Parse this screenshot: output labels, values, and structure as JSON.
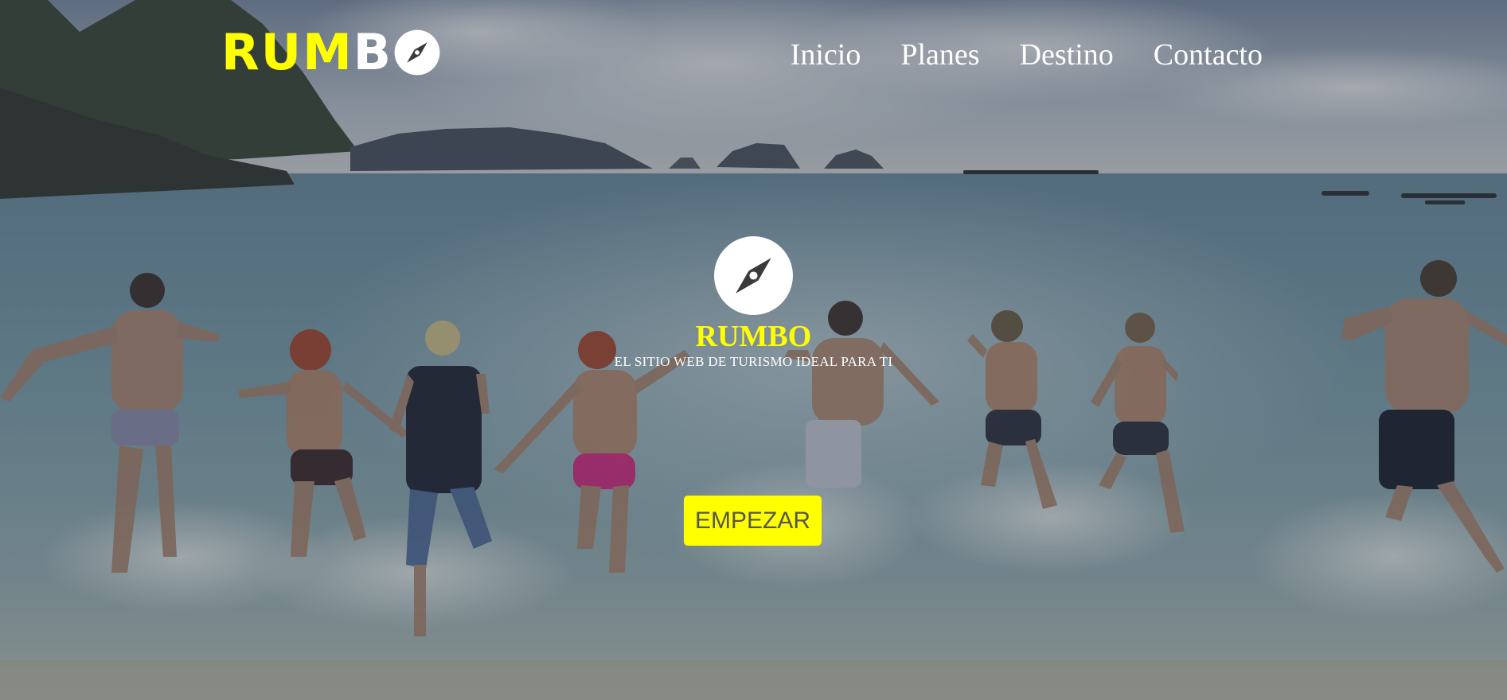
{
  "brand": {
    "logo_part1": "RUM",
    "logo_part2": "B",
    "logo_icon": "compass-icon",
    "title": "RUMBO",
    "tagline": "EL SITIO WEB DE TURISMO IDEAL PARA TI"
  },
  "nav": {
    "items": [
      {
        "label": "Inicio"
      },
      {
        "label": "Planes"
      },
      {
        "label": "Destino"
      },
      {
        "label": "Contacto"
      }
    ]
  },
  "hero": {
    "cta_label": "EMPEZAR",
    "background_icon": "beach-photo"
  },
  "colors": {
    "accent": "#ffff00",
    "text": "#ffffff",
    "button_text": "#555555"
  }
}
